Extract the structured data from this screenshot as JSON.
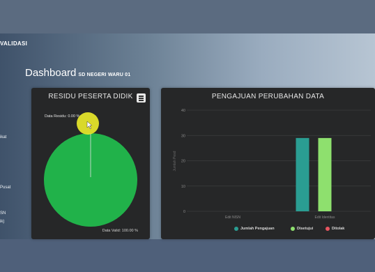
{
  "navbar": {
    "title": "VALIDASI"
  },
  "page": {
    "title": "Dashboard",
    "subtitle": "SD NEGERI WARU 01"
  },
  "sidebar_fragments": [
    "ikat",
    "Pusat",
    "SN",
    "ik)"
  ],
  "residu_panel": {
    "title": "RESIDU PESERTA DIDIK",
    "menu_icon": "hamburger-menu-icon",
    "chart_data": {
      "type": "pie",
      "title": "RESIDU PESERTA DIDIK",
      "labels": [
        "Data Residu",
        "Data Valid"
      ],
      "values": [
        0,
        100
      ],
      "colors": [
        "#9acd32",
        "#21b24a"
      ],
      "data_labels": [
        "Data Residu: 0.00 %",
        "Data Valid: 100.00 %"
      ]
    }
  },
  "pengajuan_panel": {
    "title": "PENGAJUAN PERUBAHAN DATA",
    "chart_data": {
      "type": "bar",
      "title": "PENGAJUAN PERUBAHAN DATA",
      "categories": [
        "Edit NISN",
        "Edit Identitas"
      ],
      "ylabel": "Jumlah Pesd",
      "ylim": [
        0,
        40
      ],
      "yticks": [
        0,
        10,
        20,
        30,
        40
      ],
      "grid": true,
      "legend_position": "bottom",
      "series": [
        {
          "name": "Jumlah Pengajuan",
          "color": "#2a9d92",
          "values": [
            0,
            29
          ]
        },
        {
          "name": "Disetujui",
          "color": "#8ee06e",
          "values": [
            0,
            29
          ]
        },
        {
          "name": "Ditolak",
          "color": "#e85560",
          "values": [
            0,
            0
          ]
        }
      ]
    }
  },
  "cursor": {
    "highlight_color": "#e8e82a"
  }
}
